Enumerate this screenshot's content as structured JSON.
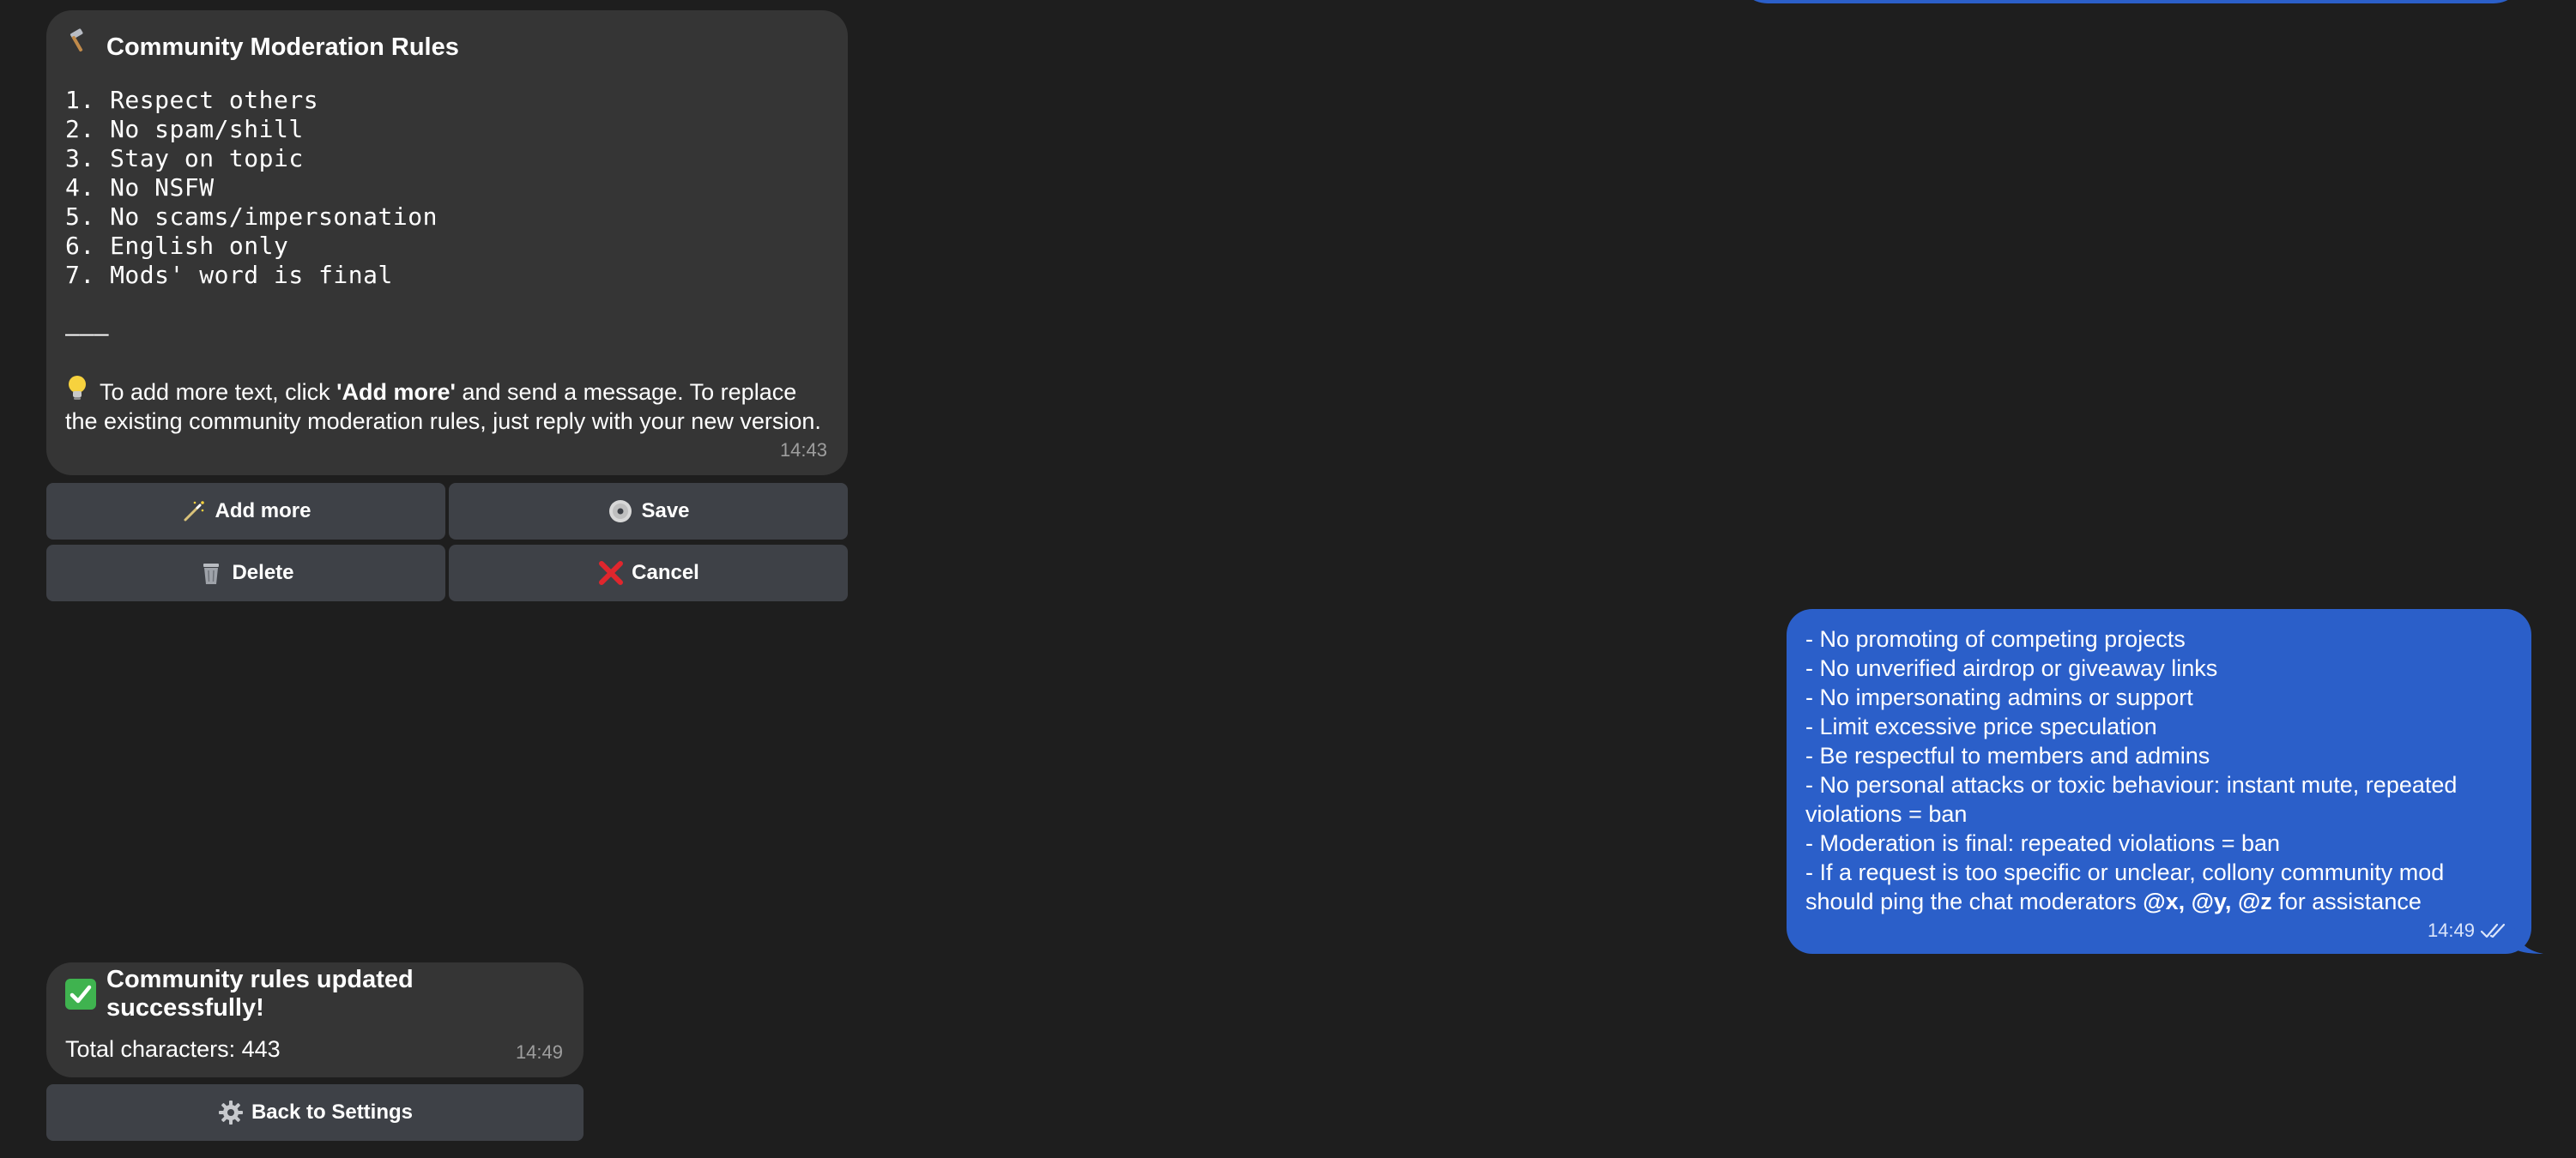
{
  "rules_message": {
    "title": "Community Moderation Rules",
    "rules": [
      "1. Respect others",
      "2. No spam/shill",
      "3. Stay on topic",
      "4. No NSFW",
      "5. No scams/impersonation",
      "6. English only",
      "7. Mods' word is final"
    ],
    "separator": "———",
    "tip_before": "To add more text, click ",
    "tip_bold": "'Add more'",
    "tip_after": " and send a message. To replace the existing community moderation rules, just reply with your new version.",
    "time": "14:43"
  },
  "rules_buttons": {
    "add_more": "Add more",
    "save": "Save",
    "delete": "Delete",
    "cancel": "Cancel"
  },
  "outgoing_message": {
    "lines": [
      "- No promoting of competing projects",
      "- No unverified airdrop or giveaway links",
      "- No impersonating admins or support",
      "- Limit excessive price speculation",
      "- Be respectful to members and admins",
      "- No personal attacks or toxic behaviour: instant mute, repeated violations = ban",
      "- Moderation is final: repeated violations = ban"
    ],
    "last_line_before": "- If a request is too specific or unclear, collony community mod should ping the chat moderators ",
    "last_line_bold": "@x, @y, @z",
    "last_line_after": " for assistance",
    "time": "14:49"
  },
  "success_message": {
    "title": "Community rules updated successfully!",
    "total": "Total characters: 443",
    "time": "14:49"
  },
  "success_buttons": {
    "back": "Back to Settings"
  },
  "colors": {
    "background": "#1e1e1e",
    "incoming_bubble": "#353535",
    "outgoing_bubble": "#2b5fc9",
    "button": "#3e4147",
    "success_check": "#3fb34f",
    "cancel_red": "#e0262d"
  }
}
